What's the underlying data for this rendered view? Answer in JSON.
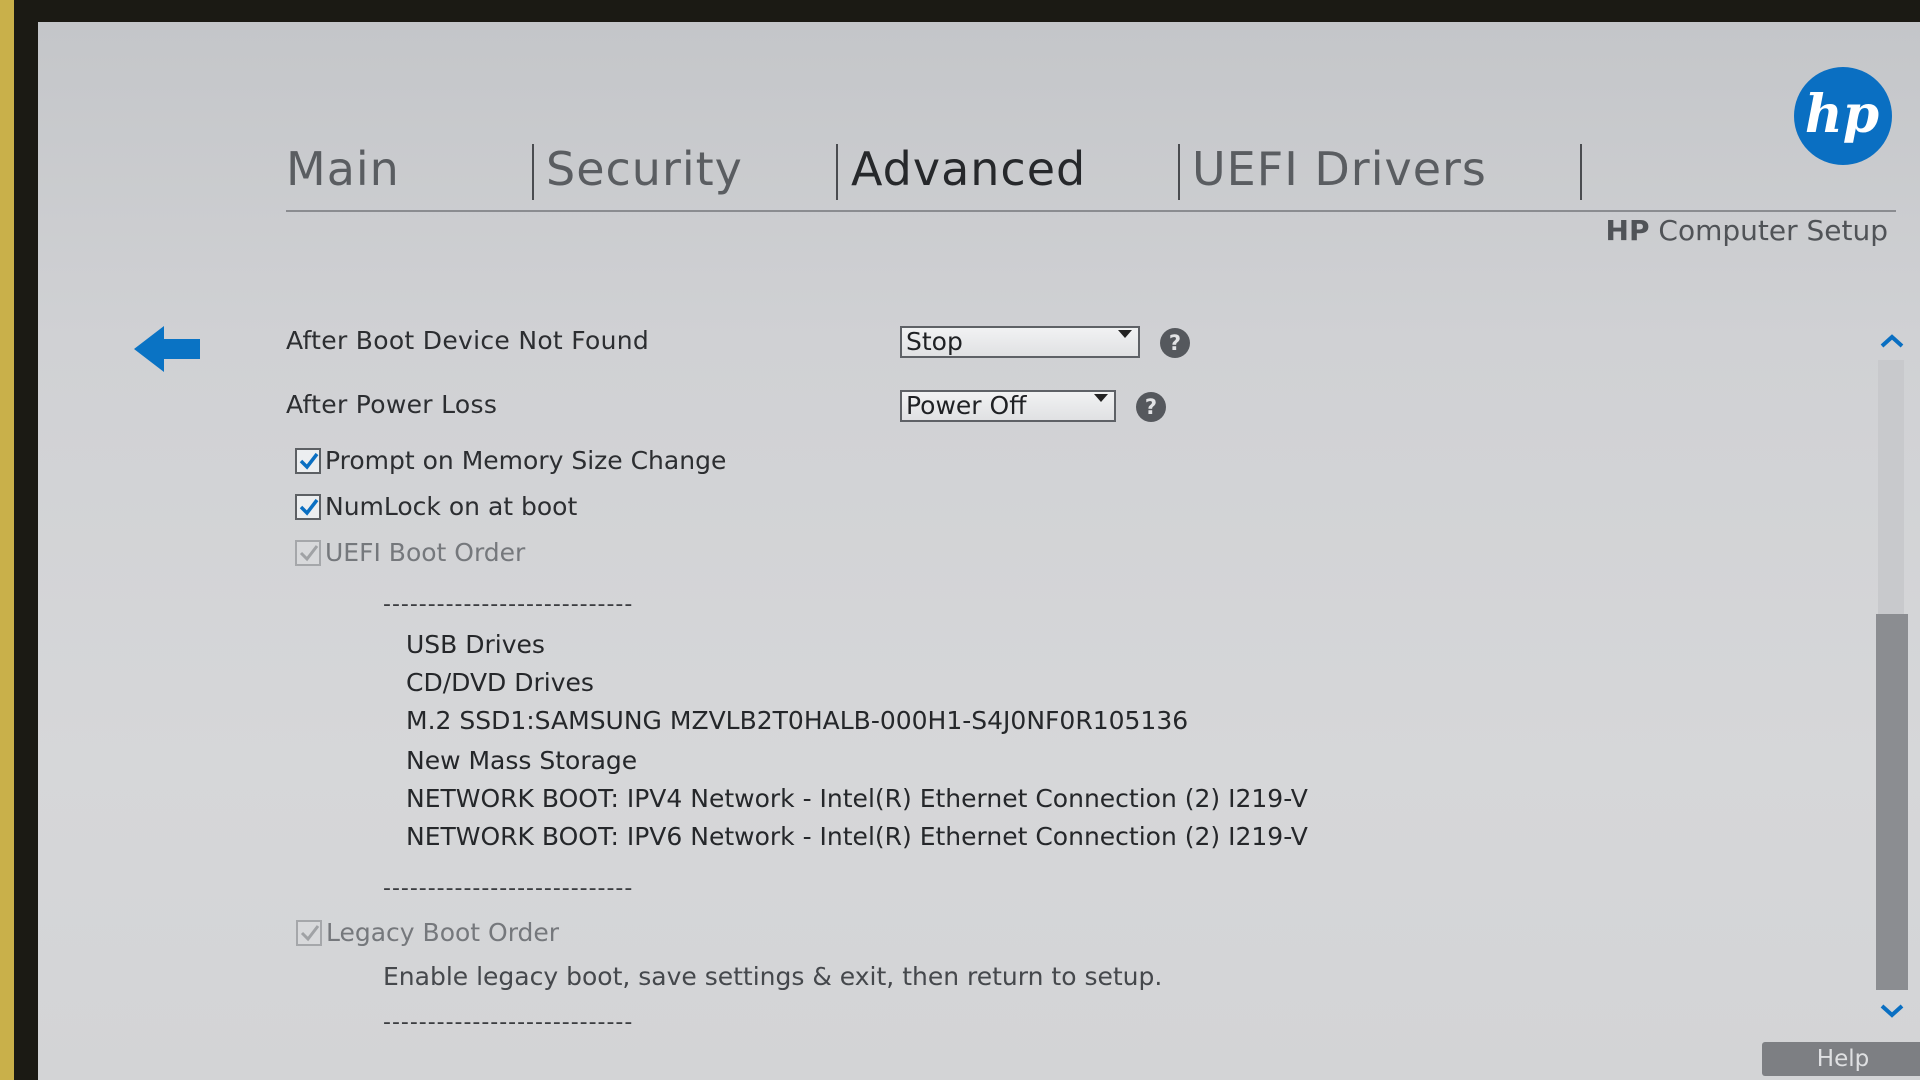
{
  "tabs": [
    {
      "label": "Main"
    },
    {
      "label": "Security"
    },
    {
      "label": "Advanced",
      "active": true
    },
    {
      "label": "UEFI Drivers"
    }
  ],
  "header": {
    "brand": "HP",
    "title": "Computer Setup",
    "logo_text": "hp"
  },
  "settings": {
    "after_boot": {
      "label": "After Boot Device Not Found",
      "value": "Stop"
    },
    "after_power": {
      "label": "After Power Loss",
      "value": "Power Off"
    },
    "help_icon": "?"
  },
  "checkboxes": [
    {
      "label": "Prompt on Memory Size Change",
      "checked": true,
      "enabled": true
    },
    {
      "label": "NumLock on at boot",
      "checked": true,
      "enabled": true
    },
    {
      "label": "UEFI Boot Order",
      "checked": true,
      "enabled": false
    }
  ],
  "separator": "----------------------------",
  "uefi_boot_order": [
    "USB Drives",
    "CD/DVD Drives",
    "M.2 SSD1:SAMSUNG MZVLB2T0HALB-000H1-S4J0NF0R105136",
    "New Mass Storage",
    "NETWORK BOOT: IPV4 Network - Intel(R) Ethernet Connection (2) I219-V",
    "NETWORK BOOT: IPV6 Network - Intel(R) Ethernet Connection (2) I219-V"
  ],
  "legacy": {
    "label": "Legacy Boot Order",
    "checked": true,
    "enabled": false,
    "note": "Enable legacy boot, save settings & exit, then return to setup."
  },
  "footer": {
    "help_label": "Help"
  },
  "colors": {
    "accent": "#0a6fc2",
    "back_arrow": "#0a73c4"
  },
  "icons": {
    "back": "back-arrow-icon",
    "scroll_up": "chevron-up-icon",
    "scroll_down": "chevron-down-icon"
  }
}
